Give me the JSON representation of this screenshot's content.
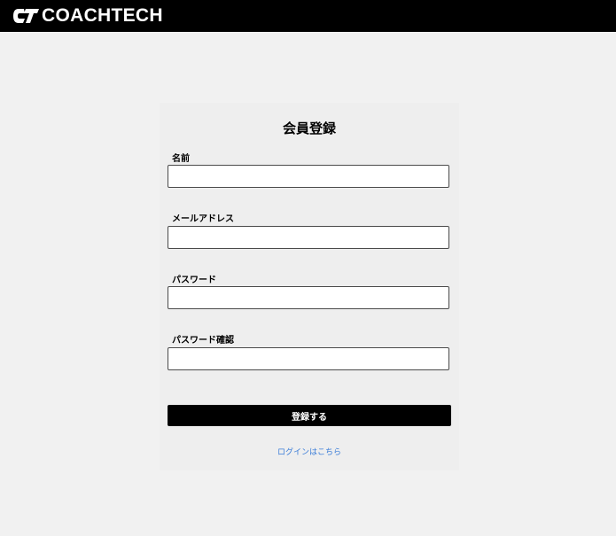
{
  "header": {
    "logo_text": "COACHTECH",
    "logo_mark_text": "CT"
  },
  "form": {
    "title": "会員登録",
    "fields": {
      "name": {
        "label": "名前",
        "value": "",
        "placeholder": ""
      },
      "email": {
        "label": "メールアドレス",
        "value": "",
        "placeholder": ""
      },
      "password": {
        "label": "パスワード",
        "value": "",
        "placeholder": ""
      },
      "password_confirm": {
        "label": "パスワード確認",
        "value": "",
        "placeholder": ""
      }
    },
    "submit_label": "登録する",
    "login_link_text": "ログインはこちら"
  },
  "colors": {
    "header_bg": "#000000",
    "page_bg": "#f1f1f1",
    "card_bg": "#eeeeee",
    "button_bg": "#000000",
    "link": "#3b7dd8"
  }
}
